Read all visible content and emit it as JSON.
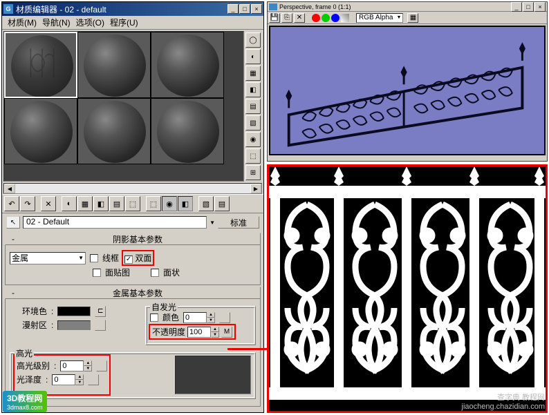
{
  "window": {
    "title": "材质编辑器 - 02 - default",
    "icon_letter": "G"
  },
  "menu": {
    "material": "材质(M)",
    "navigate": "导航(N)",
    "options": "选项(O)",
    "utilities": "程序(U)"
  },
  "material_name": "02 - Default",
  "type_button": "标准",
  "rollouts": {
    "shader_basic": {
      "title": "阴影基本参数",
      "shader": "金属",
      "wire": "线框",
      "two_sided": "双面",
      "face_map": "面贴图",
      "faceted": "面状"
    },
    "metal_basic": {
      "title": "金属基本参数",
      "ambient": "环境色",
      "diffuse": "漫射区",
      "self_illum_group": "自发光",
      "color_chk": "颜色",
      "color_val": "0",
      "opacity_label": "不透明度",
      "opacity_val": "100",
      "opacity_map": "M",
      "spec_group": "高光",
      "spec_level": "高光级别",
      "spec_level_val": "0",
      "glossiness": "光泽度",
      "glossiness_val": "0"
    }
  },
  "viewport": {
    "title": "Perspective, frame 0 (1:1)",
    "alpha_mode": "RGB Alpha"
  },
  "watermark_left": {
    "line1": "3D教程网",
    "line2": "3dmax8.com"
  },
  "watermark_right": {
    "line1": "查字典 教程网",
    "line2": "jiaocheng.chazidian.com"
  },
  "side_tools": [
    "◯",
    "◐",
    "▦",
    "◧",
    "▤",
    "▧",
    "◉",
    "⬚",
    "⊞"
  ],
  "toolbar_icons": [
    "↶",
    "↷",
    "✕",
    "◐",
    "▦",
    "◧",
    "▤",
    "⬚",
    "⬚",
    "◉",
    "◧",
    "▧",
    "▤"
  ]
}
